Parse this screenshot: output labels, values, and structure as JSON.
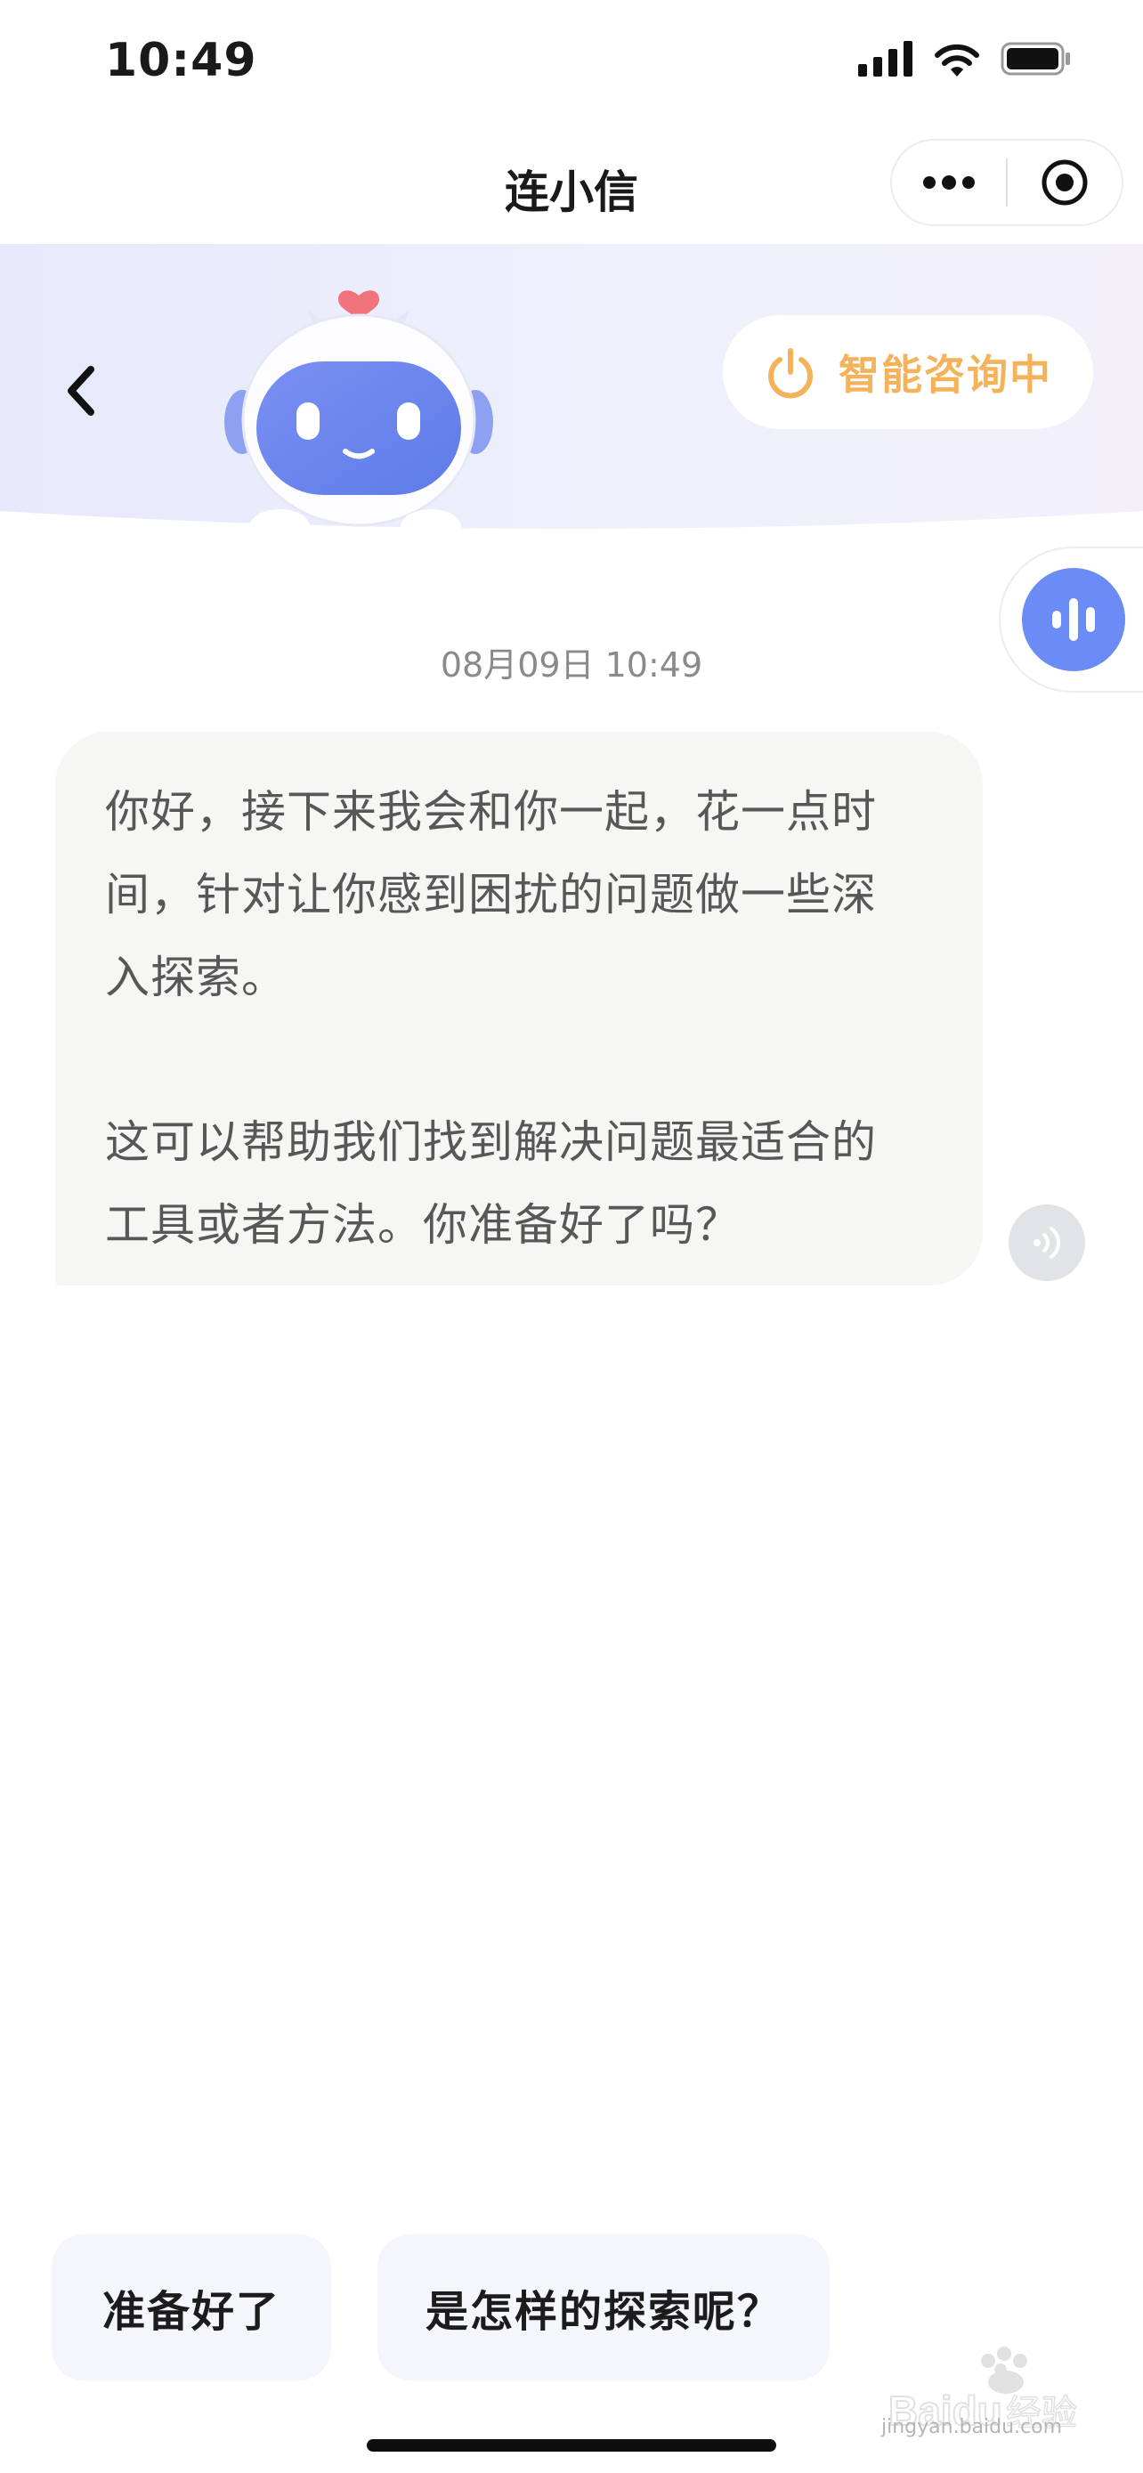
{
  "status_bar": {
    "time": "10:49"
  },
  "nav": {
    "title": "连小信"
  },
  "banner": {
    "status_label": "智能咨询中"
  },
  "chat": {
    "timestamp": "08月09日 10:49",
    "messages": [
      {
        "paragraphs": [
          {
            "lines": [
              "你好，接下来我会和你一起，花一点时",
              "间，针对让你感到困扰的问题做一些深",
              "入探索。"
            ]
          },
          {
            "lines": [
              "这可以帮助我们找到解决问题最适合的",
              "工具或者方法。你准备好了吗？"
            ]
          }
        ]
      }
    ]
  },
  "quick_replies": [
    "准备好了",
    "是怎样的探索呢？"
  ],
  "watermark": {
    "brand": "Baidu经验",
    "url": "jingyan.baidu.com"
  },
  "colors": {
    "accent_orange": "#f4b35b",
    "voice_blue": "#6b8cf7",
    "bubble_bg": "#f6f6f5",
    "quick_reply_bg": "#f4f6fc",
    "banner_tint": "#e9ecfb"
  },
  "icons": {
    "back": "chevron-left-icon",
    "more": "more-dots-icon",
    "mini_program_close": "target-icon",
    "status": "power-icon",
    "voice_float": "voice-wave-icon",
    "speaker": "speaker-icon"
  }
}
